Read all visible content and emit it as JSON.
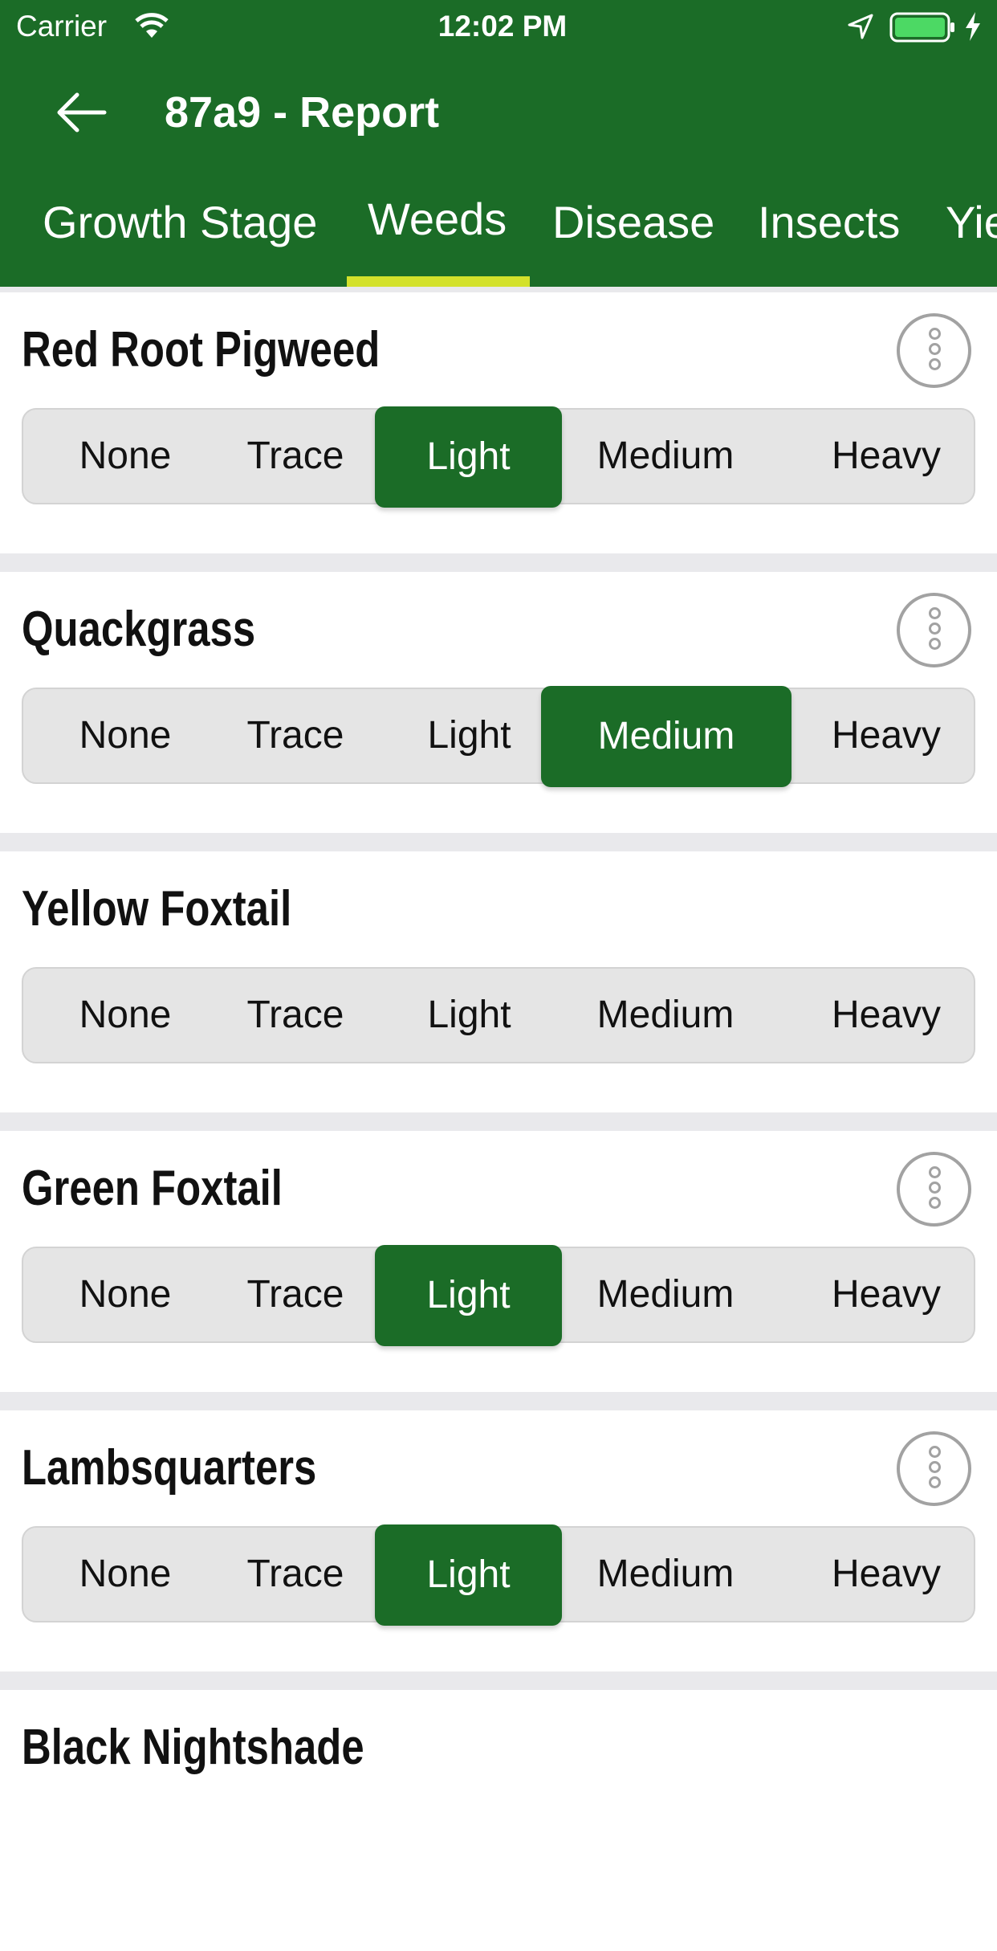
{
  "status_bar": {
    "carrier": "Carrier",
    "time": "12:02 PM",
    "icons": [
      "wifi-icon",
      "location-icon",
      "battery-icon",
      "charging-icon"
    ]
  },
  "nav": {
    "title": "87a9 - Report",
    "back_icon": "arrow-left-icon"
  },
  "tabs": [
    {
      "label": "Growth Stage",
      "selected": false
    },
    {
      "label": "Weeds",
      "selected": true
    },
    {
      "label": "Disease",
      "selected": false
    },
    {
      "label": "Insects",
      "selected": false
    },
    {
      "label": "Yie",
      "selected": false
    }
  ],
  "levels": [
    "None",
    "Trace",
    "Light",
    "Medium",
    "Heavy"
  ],
  "weeds": [
    {
      "name": "Red Root Pigweed",
      "selected": "Light",
      "has_more": true
    },
    {
      "name": "Quackgrass",
      "selected": "Medium",
      "has_more": true
    },
    {
      "name": "Yellow Foxtail",
      "selected": "",
      "has_more": false
    },
    {
      "name": "Green Foxtail",
      "selected": "Light",
      "has_more": true
    },
    {
      "name": "Lambsquarters",
      "selected": "Light",
      "has_more": true
    },
    {
      "name": "Black Nightshade",
      "selected": "",
      "has_more": false
    }
  ],
  "colors": {
    "header_green": "#1b6c27",
    "tab_indicator": "#d3e12b",
    "segment_bg": "#e5e5e5",
    "selected_green": "#1b6c27",
    "battery": "#4cd964"
  }
}
